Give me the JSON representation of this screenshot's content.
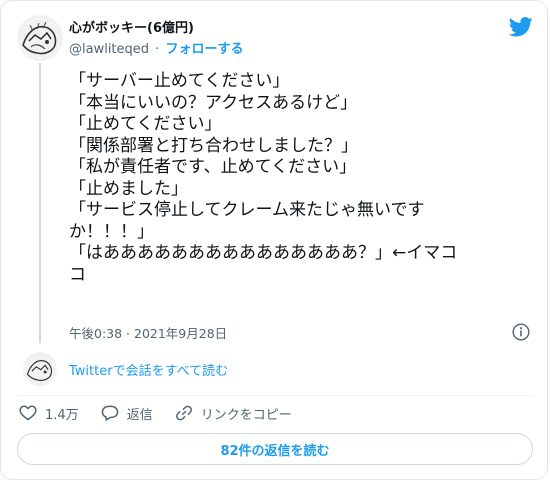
{
  "tweet": {
    "author_name": "心がボッキー(6億円)",
    "author_handle": "@lawliteqed",
    "separator": "·",
    "follow_label": "フォローする",
    "lines": [
      "「サーバー止めてください」",
      "「本当にいいの？アクセスあるけど」",
      "「止めてください」",
      "「関係部署と打ち合わせしました？」",
      "「私が責任者です、止めてください」",
      "「止めました」",
      "「サービス停止してクレーム来たじゃ無いです",
      "か！！！」",
      "「はあああああああああああああああ？」←イマコ",
      "コ"
    ],
    "timestamp": "午後0:38 · 2021年9月28日"
  },
  "conversation": {
    "link_label": "Twitterで会話をすべて読む"
  },
  "actions": {
    "like_count": "1.4万",
    "reply_label": "返信",
    "copy_link_label": "リンクをコピー"
  },
  "replies_button": {
    "label": "82件の返信を読む"
  },
  "icons": {
    "bird": "twitter-bird-icon",
    "info": "info-icon",
    "like": "heart-icon",
    "reply": "speech-bubble-icon",
    "link": "link-icon"
  },
  "colors": {
    "accent": "#1d9bf0",
    "text": "#0f1419",
    "secondary": "#536471",
    "border": "#cfd9de"
  }
}
